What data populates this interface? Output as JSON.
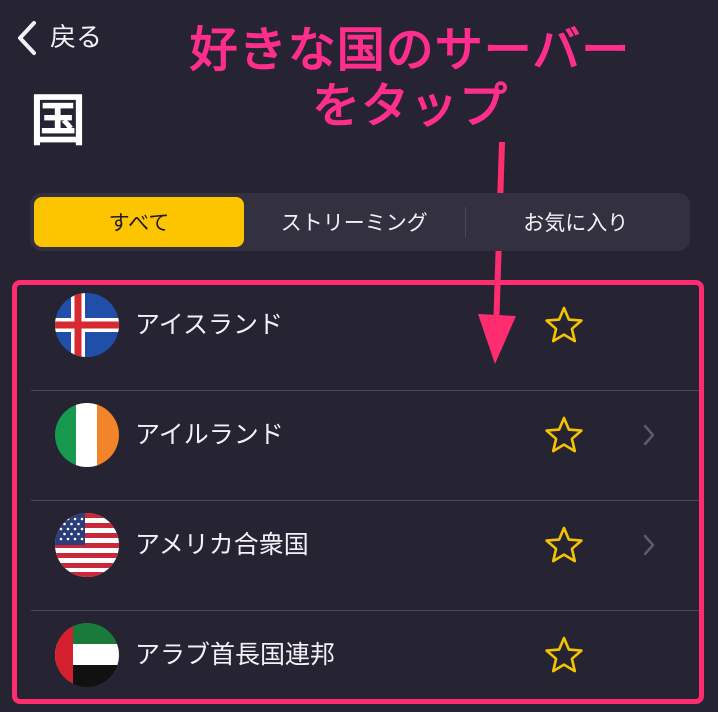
{
  "nav": {
    "back_label": "戻る"
  },
  "page": {
    "title": "国"
  },
  "annotation": {
    "line1": "好きな国のサーバー",
    "line2": "をタップ",
    "color": "#ff2d8c"
  },
  "tabs": [
    {
      "label": "すべて",
      "selected": true
    },
    {
      "label": "ストリーミング",
      "selected": false
    },
    {
      "label": "お気に入り",
      "selected": false
    }
  ],
  "countries": [
    {
      "name": "アイスランド",
      "flag": "iceland-flag-icon",
      "favorite": false,
      "has_chevron": false
    },
    {
      "name": "アイルランド",
      "flag": "ireland-flag-icon",
      "favorite": false,
      "has_chevron": true
    },
    {
      "name": "アメリカ合衆国",
      "flag": "usa-flag-icon",
      "favorite": false,
      "has_chevron": true
    },
    {
      "name": "アラブ首長国連邦",
      "flag": "uae-flag-icon",
      "favorite": false,
      "has_chevron": false
    }
  ],
  "colors": {
    "background": "#262433",
    "accent": "#fdc400",
    "highlight_border": "#ff2d6f",
    "star": "#f5c400"
  }
}
